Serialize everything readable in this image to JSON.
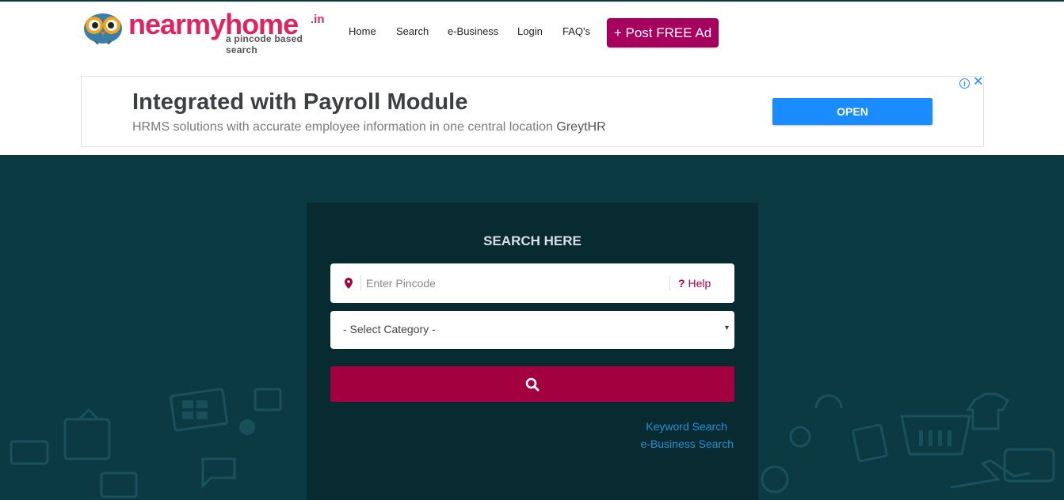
{
  "header": {
    "logo": {
      "name": "nearmyhome",
      "tld": ".in",
      "tagline": "a pincode based search"
    },
    "nav": [
      "Home",
      "Search",
      "e-Business",
      "Login",
      "FAQ's"
    ],
    "post_ad_label": "+ Post FREE Ad",
    "accent_color": "#a8005f"
  },
  "ad": {
    "title": "Integrated with Payroll Module",
    "description": "HRMS solutions with accurate employee information in one central location",
    "brand": "GreytHR",
    "cta": "OPEN",
    "info_icon": "info-icon",
    "close_icon": "close-icon"
  },
  "search": {
    "title": "SEARCH HERE",
    "pincode_placeholder": "Enter Pincode",
    "pincode_value": "",
    "help_mark": "?",
    "help_label": "Help",
    "category_selected": "- Select Category -",
    "search_icon": "search-icon",
    "keyword_link": "Keyword Search",
    "ebusiness_link": "e-Business Search",
    "button_color": "#a3003f",
    "background_color": "#0b3a43"
  }
}
